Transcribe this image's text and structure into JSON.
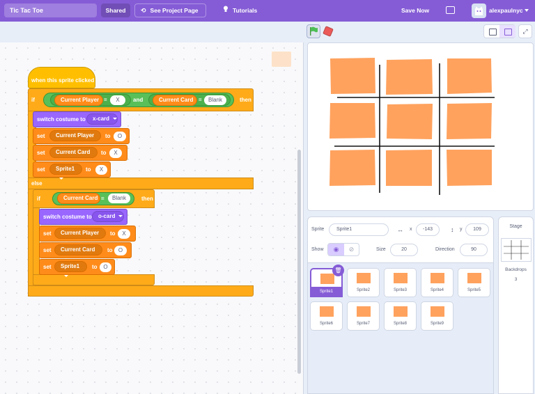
{
  "header": {
    "project_title": "Tic Tac Toe",
    "shared_label": "Shared",
    "see_project_label": "See Project Page",
    "tutorials_label": "Tutorials",
    "save_label": "Save Now",
    "username": "alexpaulnyc"
  },
  "code": {
    "hat_label": "when this sprite clicked",
    "if_label": "if",
    "then_label": "then",
    "and_label": "and",
    "else_label": "else",
    "eq_label": "=",
    "set_label": "set",
    "to_label": "to",
    "switch_costume_label": "switch costume to",
    "current_player": "Current Player",
    "current_card": "Current Card",
    "sprite1": "Sprite1",
    "val_x": "X",
    "val_o": "O",
    "val_blank": "Blank",
    "costume_x": "x-card",
    "costume_o": "o-card"
  },
  "sprite_info": {
    "sprite_label": "Sprite",
    "sprite_name": "Sprite1",
    "x_label": "x",
    "x_value": "-143",
    "y_label": "y",
    "y_value": "109",
    "show_label": "Show",
    "size_label": "Size",
    "size_value": "20",
    "direction_label": "Direction",
    "direction_value": "90"
  },
  "sprites": [
    "Sprite1",
    "Sprite2",
    "Sprite3",
    "Sprite4",
    "Sprite5",
    "Sprite6",
    "Sprite7",
    "Sprite8",
    "Sprite9"
  ],
  "stage_panel": {
    "title": "Stage",
    "backdrops_label": "Backdrops",
    "backdrops_count": "3"
  },
  "colors": {
    "brand": "#855cd6",
    "control": "#ffab19",
    "looks": "#9966ff",
    "variables": "#ff8c1a",
    "operators": "#59c059",
    "card": "#ffa25e",
    "stop": "#ec5959"
  },
  "icons": [
    "remix-icon",
    "lightbulb-icon",
    "folder-icon",
    "caret-down-icon",
    "green-flag-icon",
    "stop-icon",
    "small-stage-icon",
    "normal-stage-icon",
    "fullscreen-icon",
    "x-arrow-icon",
    "y-arrow-icon",
    "eye-icon",
    "eye-closed-icon",
    "trash-icon"
  ]
}
